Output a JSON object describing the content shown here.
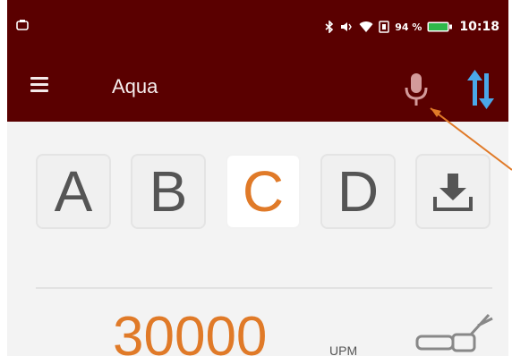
{
  "status_bar": {
    "battery_percent": "94 %",
    "time": "10:18",
    "icons": [
      "bluetooth-icon",
      "vibrate-icon",
      "wifi-icon",
      "nfc-icon",
      "battery-icon"
    ]
  },
  "app_bar": {
    "title": "Aqua",
    "icons": [
      "menu-icon",
      "microphone-icon",
      "sort-icon"
    ]
  },
  "tabs": {
    "items": [
      {
        "label": "A",
        "active": false
      },
      {
        "label": "B",
        "active": false
      },
      {
        "label": "C",
        "active": true
      },
      {
        "label": "D",
        "active": false
      }
    ],
    "download_icon": "download-icon"
  },
  "speed": {
    "value": "30000",
    "unit": "UPM",
    "icon": "handpiece-icon"
  },
  "colors": {
    "app_bar": "#5a0000",
    "accent": "#e07a28",
    "sort_icon": "#4aa8e8",
    "mic_icon": "#d39a9a",
    "annotation": "#e07a28"
  }
}
